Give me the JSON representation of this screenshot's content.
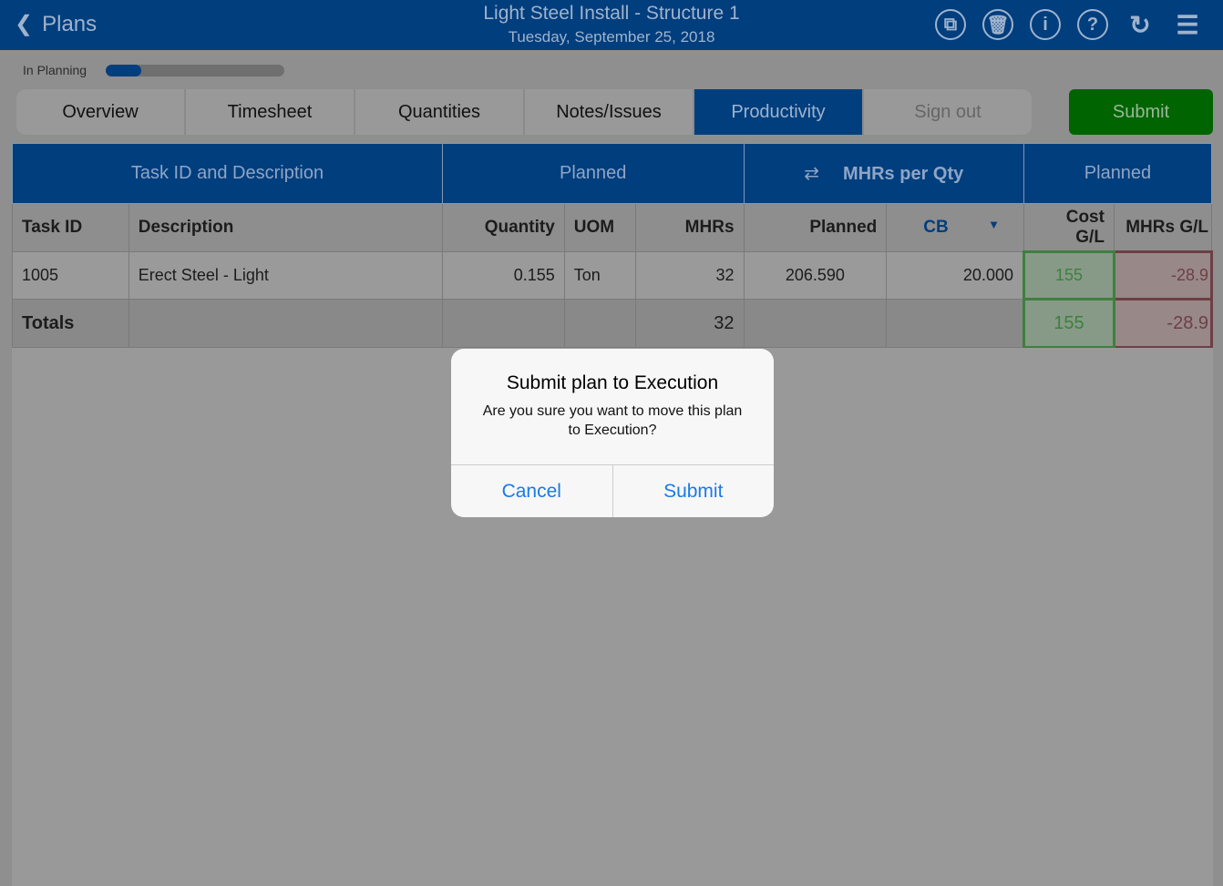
{
  "header": {
    "back_label": "Plans",
    "title": "Light Steel Install - Structure 1",
    "date": "Tuesday, September 25, 2018",
    "icons": [
      "copy-icon",
      "trash-icon",
      "info-icon",
      "help-icon",
      "refresh-icon",
      "menu-icon"
    ]
  },
  "status": {
    "label": "In Planning",
    "progress_percent": 20
  },
  "tabs": [
    "Overview",
    "Timesheet",
    "Quantities",
    "Notes/Issues",
    "Productivity",
    "Sign out"
  ],
  "active_tab": "Productivity",
  "submit_label": "Submit",
  "table": {
    "groups": [
      "Task ID and Description",
      "Planned",
      "MHRs per Qty",
      "Planned"
    ],
    "headers": [
      "Task ID",
      "Description",
      "Quantity",
      "UOM",
      "MHRs",
      "Planned",
      "CB",
      "Cost G/L",
      "MHRs G/L"
    ],
    "rows": [
      {
        "task_id": "1005",
        "description": "Erect Steel - Light",
        "quantity": "0.155",
        "uom": "Ton",
        "mhrs": "32",
        "planned": "206.590",
        "cb": "20.000",
        "cost_gl": "155",
        "mhrs_gl": "-28.9"
      }
    ],
    "totals": {
      "label": "Totals",
      "mhrs": "32",
      "cost_gl": "155",
      "mhrs_gl": "-28.9"
    }
  },
  "dialog": {
    "title": "Submit plan to Execution",
    "message": "Are you sure you want to move this plan to Execution?",
    "cancel": "Cancel",
    "submit": "Submit"
  },
  "colors": {
    "brand": "#003e7e",
    "submit": "#006400",
    "gain": "#3f7f3f",
    "loss": "#6d3f45"
  }
}
